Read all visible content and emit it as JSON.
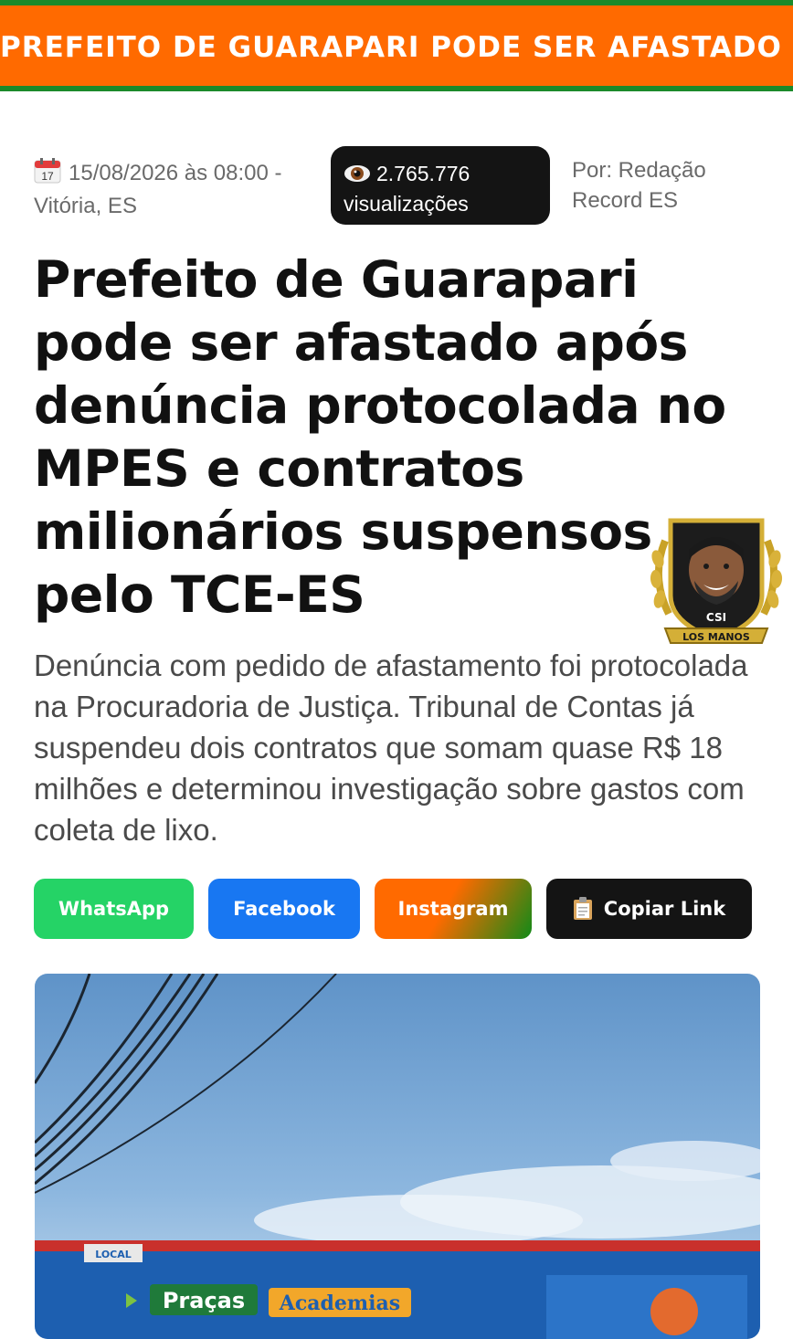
{
  "ticker": {
    "text": "PREFEITO DE GUARAPARI PODE SER AFASTADO - DI"
  },
  "meta": {
    "calendar_icon": "calendar-icon",
    "calendar_day": "17",
    "date_line": "15/08/2026 às 08:00 -",
    "location": "Vitória, ES",
    "views_icon": "eye-icon",
    "views_count": "2.765.776",
    "views_label": "visualizações",
    "author_line1": "Por: Redação",
    "author_line2": "Record ES"
  },
  "article": {
    "headline": "Prefeito de Guarapari pode ser afastado após denúncia protocolada no MPES e contratos milionários suspensos pelo TCE-ES",
    "subtitle": "Denúncia com pedido de afastamento foi protocolada na Procuradoria de Justiça. Tribunal de Contas já suspendeu dois contratos que somam quase R$ 18 milhões e determinou investigação sobre gastos com coleta de lixo."
  },
  "badge": {
    "top": "CSI",
    "ribbon": "LOS MANOS"
  },
  "share": {
    "whatsapp": "WhatsApp",
    "facebook": "Facebook",
    "instagram": "Instagram",
    "copy_icon": "clipboard-icon",
    "copy": "Copiar Link"
  },
  "photo": {
    "billboard_tag": "LOCAL",
    "billboard_word1": "Praças",
    "billboard_word2": "Academias"
  },
  "colors": {
    "ticker_bg": "#ff6a00",
    "ticker_border": "#1a8a2a",
    "whatsapp": "#25d366",
    "facebook": "#1877f2",
    "copy_bg": "#141414"
  }
}
